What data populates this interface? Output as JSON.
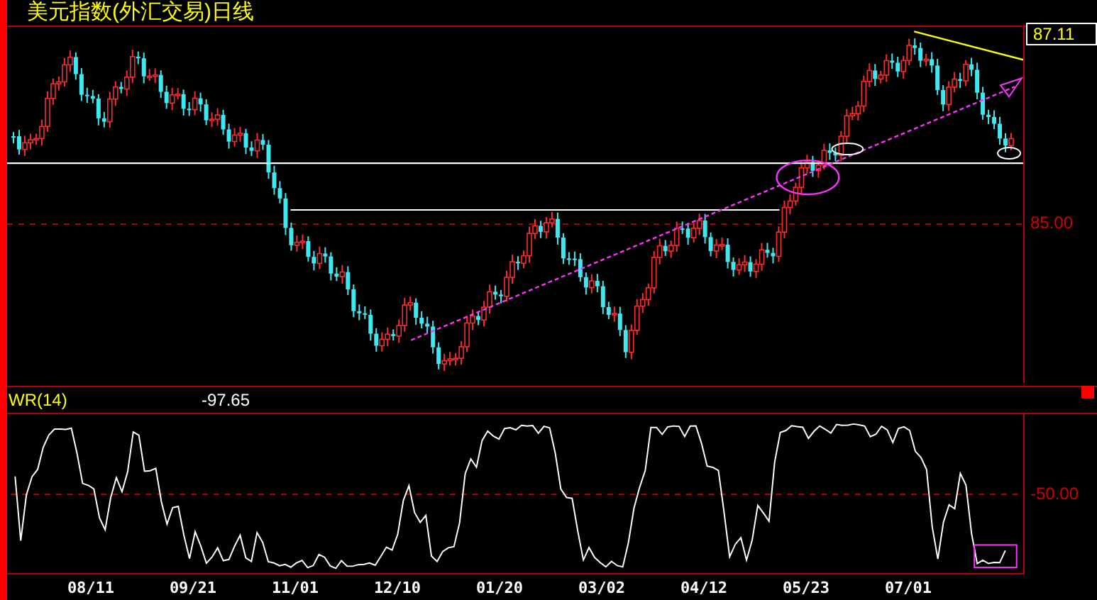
{
  "title": "美元指数(外汇交易)日线",
  "price_axis": {
    "current_price": "87.11",
    "tick": "85.00"
  },
  "indicator": {
    "name": "WR(14)",
    "value": "-97.65",
    "tick": "-50.00"
  },
  "date_axis": [
    "08/11",
    "09/21",
    "11/01",
    "12/10",
    "01/20",
    "03/02",
    "04/12",
    "05/23",
    "07/01"
  ]
}
